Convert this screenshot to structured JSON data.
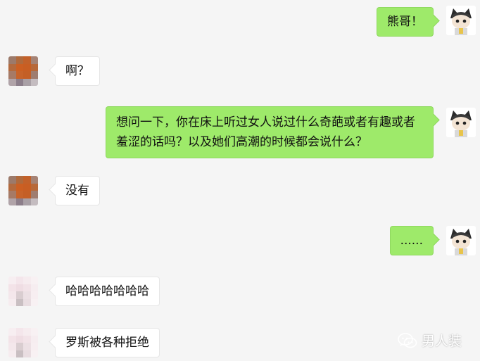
{
  "messages": [
    {
      "side": "out",
      "text": "熊哥！"
    },
    {
      "side": "in",
      "text": "啊？"
    },
    {
      "side": "out",
      "text": "想问一下，你在床上听过女人说过什么奇葩或者有趣或者羞涩的话吗？以及她们高潮的时候都会说什么？"
    },
    {
      "side": "in",
      "text": "没有"
    },
    {
      "side": "out",
      "text": "......"
    },
    {
      "side": "in",
      "text": "哈哈哈哈哈哈哈"
    },
    {
      "side": "in",
      "text": "罗斯被各种拒绝"
    }
  ],
  "watermark": {
    "text": "男人装",
    "icon": "wechat-icon"
  },
  "colors": {
    "background": "#f5f5f5",
    "outgoing_bubble": "#9eea6a",
    "incoming_bubble": "#ffffff",
    "contact_avatar": "#c8602a"
  }
}
